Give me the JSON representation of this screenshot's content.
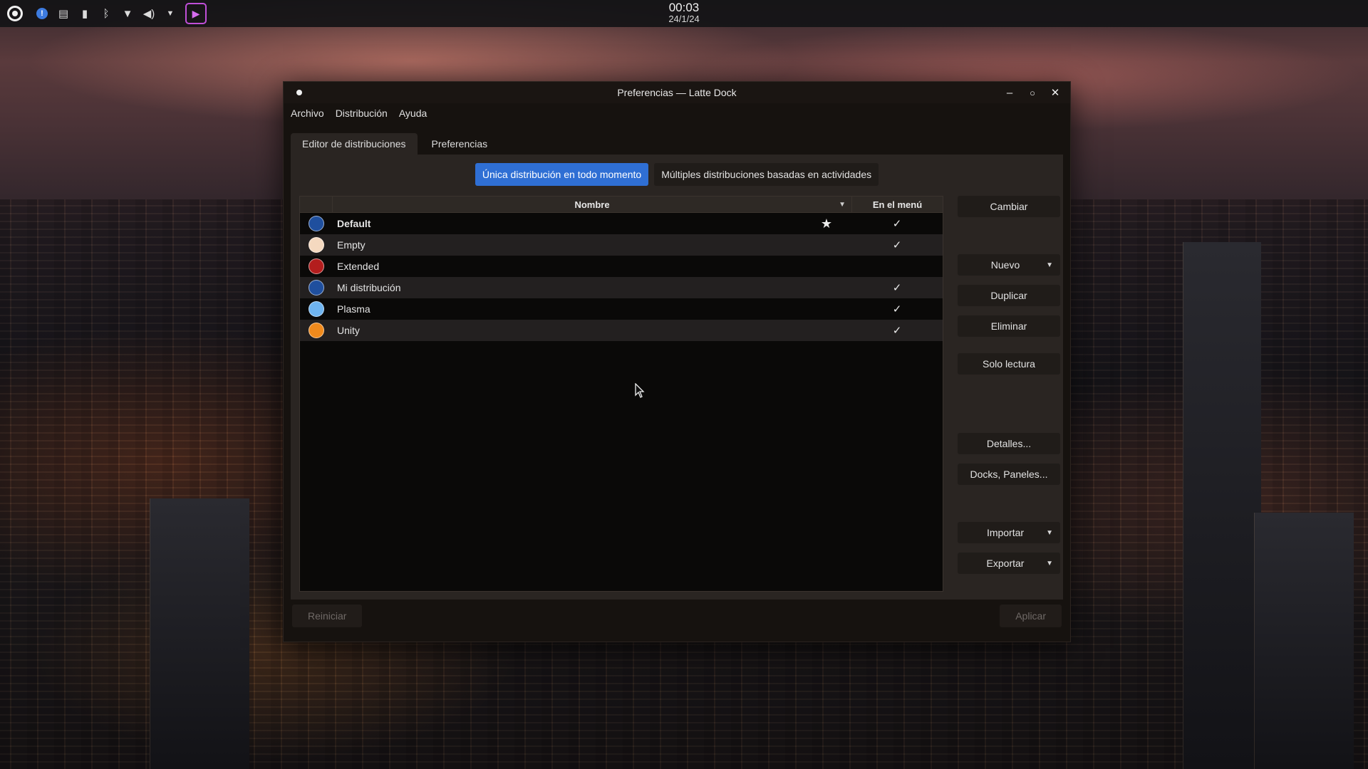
{
  "topbar": {
    "clock_time": "00:03",
    "clock_date": "24/1/24",
    "tray_icons": [
      "launcher-icon",
      "notifications-badge",
      "clipboard-icon",
      "battery-icon",
      "bluetooth-icon",
      "wifi-icon",
      "volume-icon",
      "tray-expand-icon",
      "screen-recorder-icon"
    ]
  },
  "window": {
    "title": "Preferencias — Latte Dock",
    "menu": {
      "archivo": "Archivo",
      "distribucion": "Distribución",
      "ayuda": "Ayuda"
    },
    "tabs": {
      "editor": "Editor de distribuciones",
      "preferencias": "Preferencias"
    },
    "modes": {
      "single": "Única distribución en todo momento",
      "multiple": "Múltiples distribuciones basadas en actividades"
    },
    "table": {
      "col_name": "Nombre",
      "col_menu": "En el menú",
      "rows": [
        {
          "name": "Default",
          "color": "#1f4f9e",
          "star": "★",
          "menu": "✓",
          "bold": true
        },
        {
          "name": "Empty",
          "color": "#f5d9c0",
          "star": "",
          "menu": "✓",
          "bold": false
        },
        {
          "name": "Extended",
          "color": "#b31d1d",
          "star": "",
          "menu": "",
          "bold": false
        },
        {
          "name": "Mi distribución",
          "color": "#1f4f9e",
          "star": "",
          "menu": "✓",
          "bold": false
        },
        {
          "name": "Plasma",
          "color": "#6fb4f0",
          "star": "",
          "menu": "✓",
          "bold": false
        },
        {
          "name": "Unity",
          "color": "#f08a1c",
          "star": "",
          "menu": "✓",
          "bold": false
        }
      ]
    },
    "side_buttons": {
      "cambiar": "Cambiar",
      "nuevo": "Nuevo",
      "duplicar": "Duplicar",
      "eliminar": "Eliminar",
      "solo_lectura": "Solo lectura",
      "detalles": "Detalles...",
      "docks": "Docks, Paneles...",
      "importar": "Importar",
      "exportar": "Exportar"
    },
    "footer": {
      "reiniciar": "Reiniciar",
      "aplicar": "Aplicar"
    }
  },
  "colors": {
    "accent": "#2f6fd4",
    "window_bg": "#16120f",
    "panel_bg": "#2a2522"
  }
}
